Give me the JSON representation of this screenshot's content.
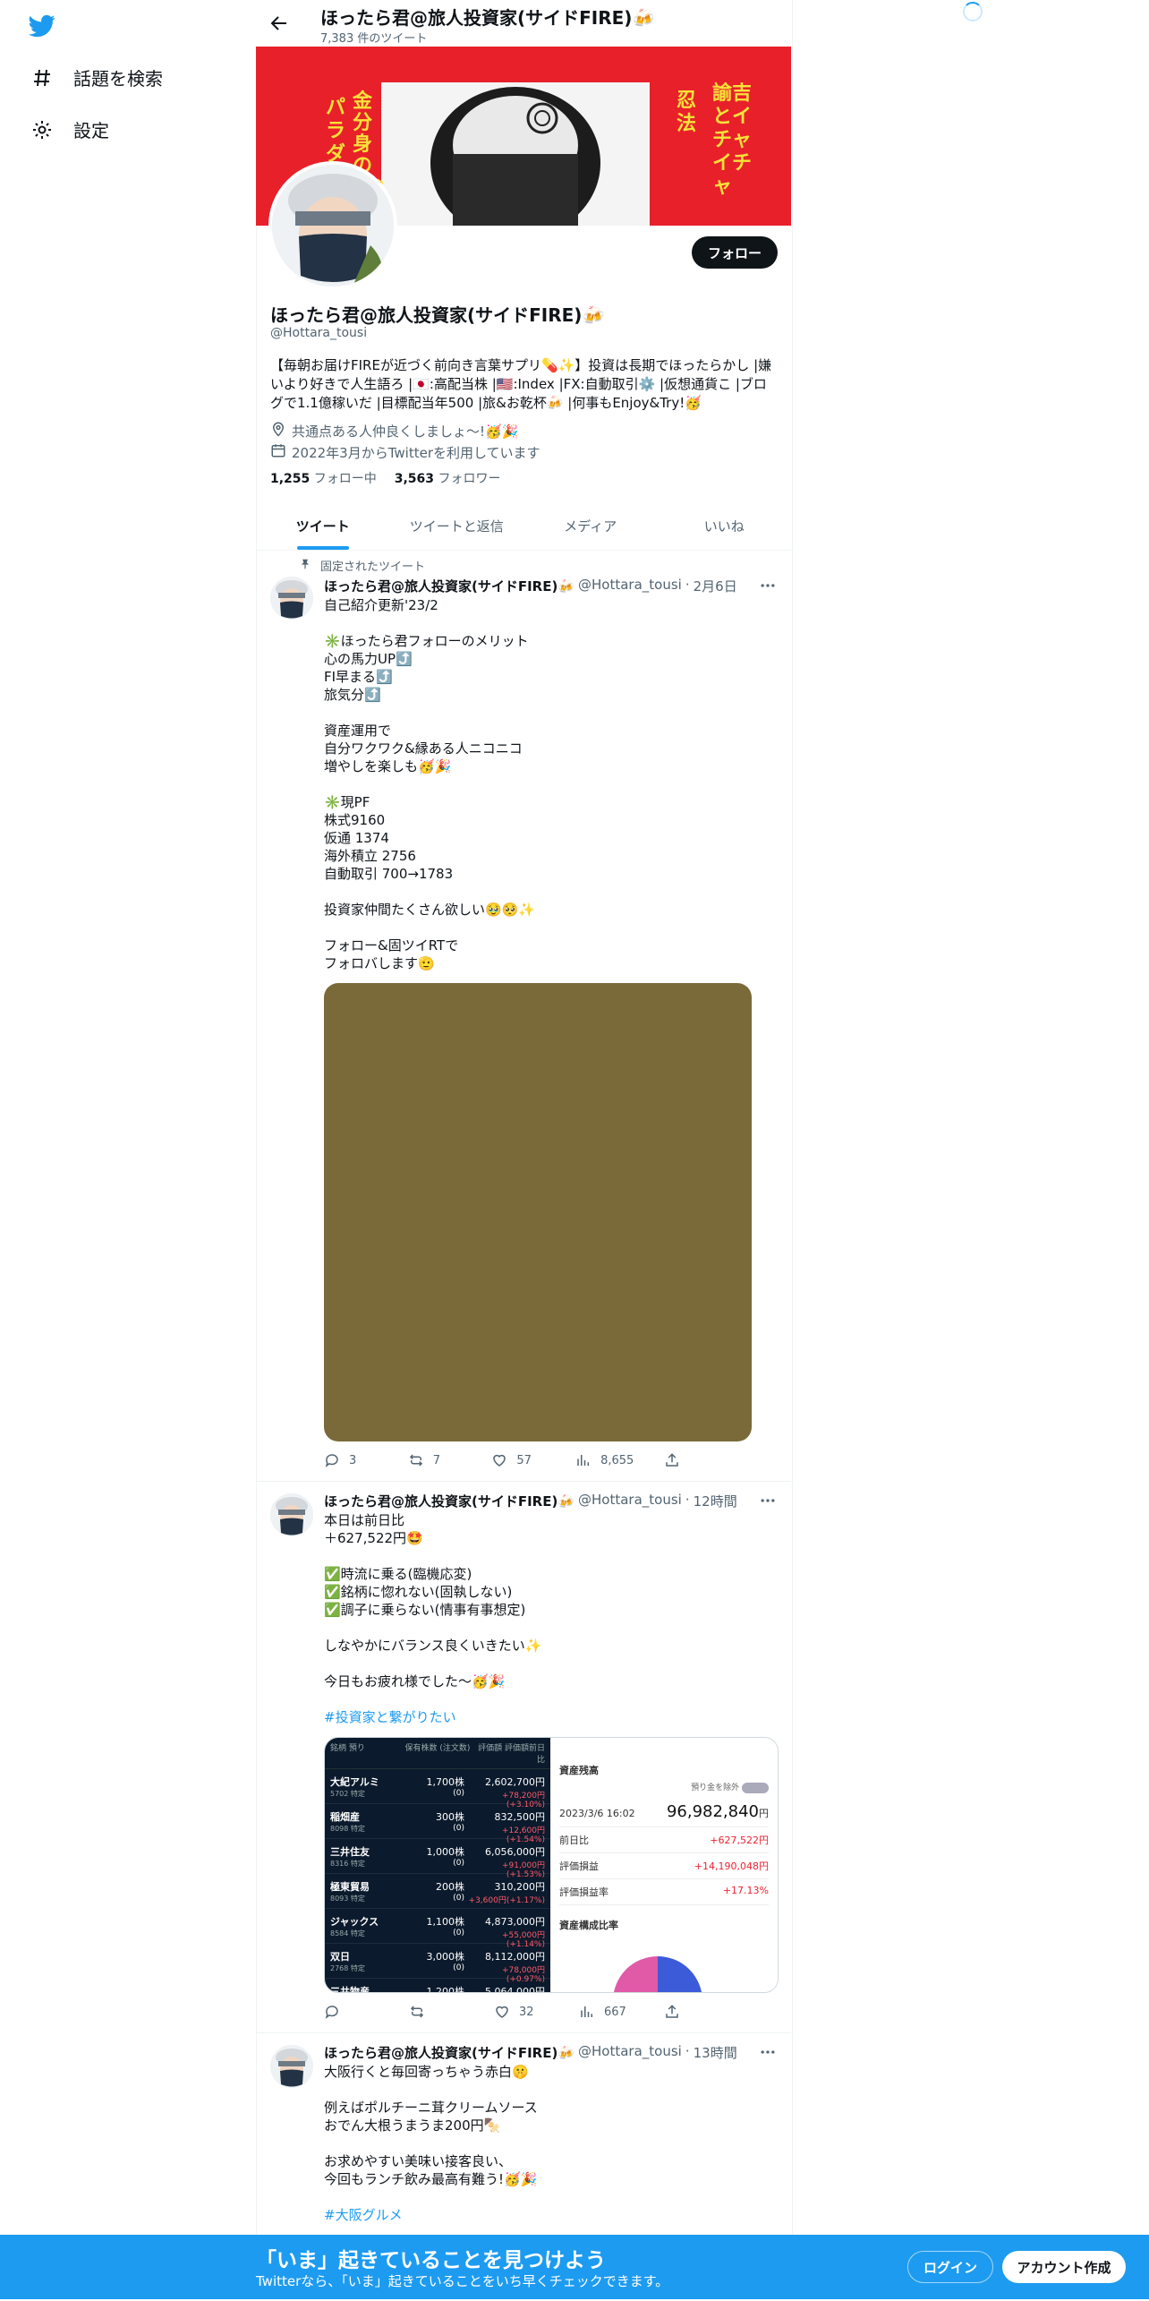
{
  "nav": {
    "items": [
      {
        "label": "話題を検索",
        "icon": "hashtag-icon"
      },
      {
        "label": "設定",
        "icon": "gear-icon"
      }
    ]
  },
  "header": {
    "name": "ほったら君@旅人投資家(サイドFIRE)🍻",
    "tweet_count": "7,383 件のツイート"
  },
  "banner": {
    "text_left": "金分身の術♪",
    "text_left2": "パラダイ",
    "text_right": "諭吉とイチャイチャ",
    "text_right2": "忍法"
  },
  "profile": {
    "follow_label": "フォロー",
    "name": "ほったら君@旅人投資家(サイドFIRE)🍻",
    "handle": "@Hottara_tousi",
    "bio": "【毎朝お届けFIREが近づく前向き言葉サプリ💊✨】投資は長期でほったらかし |嫌いより好きで人生語ろ |🇯🇵:高配当株 |🇺🇸:Index |FX:自動取引⚙️ |仮想通貨こ |ブログで1.1億稼いだ |目標配当年500 |旅&お乾杯🍻 |何事もEnjoy&Try!🥳",
    "location": "共通点ある人仲良くしましょ〜!🥳🎉",
    "joined": "2022年3月からTwitterを利用しています",
    "following_count": "1,255",
    "following_label": "フォロー中",
    "followers_count": "3,563",
    "followers_label": "フォロワー"
  },
  "tabs": [
    "ツイート",
    "ツイートと返信",
    "メディア",
    "いいね"
  ],
  "tweets": [
    {
      "pinned_label": "固定されたツイート",
      "name": "ほったら君@旅人投資家(サイドFIRE)🍻",
      "handle": "@Hottara_tousi",
      "time": "2月6日",
      "body": "自己紹介更新'23/2\n\n✳️ほったら君フォローのメリット\n心の馬力UP⤴️\nFI早まる⤴️\n旅気分⤴️\n\n資産運用で\n自分ワクワク&縁ある人ニコニコ\n増やしを楽しも🥳🎉\n\n✳️現PF\n株式9160\n仮通 1374\n海外積立 2756\n自動取引 700→1783\n\n投資家仲間たくさん欲しい🥹🥺✨\n\nフォロー&固ツイRTで\nフォロバします🫡",
      "replies": "3",
      "retweets": "7",
      "likes": "57",
      "views": "8,655"
    },
    {
      "name": "ほったら君@旅人投資家(サイドFIRE)🍻",
      "handle": "@Hottara_tousi",
      "time": "12時間",
      "body": "本日は前日比\n＋627,522円🤩\n\n✅時流に乗る(臨機応変)\n✅銘柄に惚れない(固執しない)\n✅調子に乗らない(情事有事想定)\n\nしなやかにバランス良くいきたい✨\n\n今日もお疲れ様でした〜🥳🎉",
      "hashtag": "#投資家と繋がりたい",
      "replies": "",
      "retweets": "",
      "likes": "32",
      "views": "667",
      "media": {
        "stock_headers": [
          "銘柄 預り",
          "保有株数 (注文数)",
          "評価額 評価額前日比"
        ],
        "stocks": [
          {
            "name": "大紀アルミ",
            "code": "5702 特定",
            "qty": "1,700株",
            "q2": "(0)",
            "val": "2,602,700円",
            "chg": "+78,200円(+3.10%)"
          },
          {
            "name": "稲畑産",
            "code": "8098 特定",
            "qty": "300株",
            "q2": "(0)",
            "val": "832,500円",
            "chg": "+12,600円(+1.54%)"
          },
          {
            "name": "三井住友",
            "code": "8316 特定",
            "qty": "1,000株",
            "q2": "(0)",
            "val": "6,056,000円",
            "chg": "+91,000円(+1.53%)"
          },
          {
            "name": "極東貿易",
            "code": "8093 特定",
            "qty": "200株",
            "q2": "(0)",
            "val": "310,200円",
            "chg": "+3,600円(+1.17%)"
          },
          {
            "name": "ジャックス",
            "code": "8584 特定",
            "qty": "1,100株",
            "q2": "(0)",
            "val": "4,873,000円",
            "chg": "+55,000円(+1.14%)"
          },
          {
            "name": "双日",
            "code": "2768 特定",
            "qty": "3,000株",
            "q2": "(0)",
            "val": "8,112,000円",
            "chg": "+78,000円(+0.97%)"
          },
          {
            "name": "三井物産",
            "code": "",
            "qty": "1,200株",
            "q2": "",
            "val": "5,064,000円",
            "chg": ""
          }
        ],
        "asset_title": "資産残高",
        "asset_toggle": "預り金を除外",
        "asset_date": "2023/3/6 16:02",
        "asset_total": "96,982,840",
        "asset_unit": "円",
        "rows": [
          {
            "k": "前日比",
            "v": "+627,522円"
          },
          {
            "k": "評価損益",
            "v": "+14,190,048円"
          },
          {
            "k": "評価損益率",
            "v": "+17.13%"
          }
        ],
        "composition_title": "資産構成比率"
      }
    },
    {
      "name": "ほったら君@旅人投資家(サイドFIRE)🍻",
      "handle": "@Hottara_tousi",
      "time": "13時間",
      "body": "大阪行くと毎回寄っちゃう赤白🤫\n\n例えばポルチーニ茸クリームソース\nおでん大根うまうま200円🍢\n\nお求めやすい美味い接客良い、\n今回もランチ飲み最高有難う!🥳🎉",
      "hashtag": "#大阪グルメ"
    }
  ],
  "bottom_bar": {
    "title": "「いま」起きていることを見つけよう",
    "subtitle": "Twitterなら、「いま」起きていることをいち早くチェックできます。",
    "login": "ログイン",
    "signup": "アカウント作成"
  },
  "colors": {
    "accent": "#1d9bf0",
    "banner": "#e8202a",
    "media_placeholder": "#7a6a39"
  }
}
